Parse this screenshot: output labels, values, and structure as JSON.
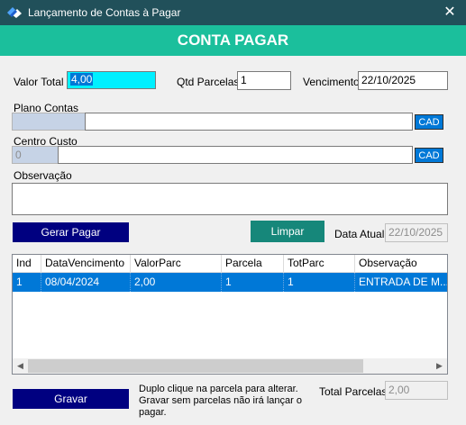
{
  "window": {
    "title": "Lançamento de Contas à Pagar",
    "close_glyph": "✕",
    "icon": "app-logo-icon"
  },
  "header": {
    "title": "CONTA PAGAR"
  },
  "form": {
    "valor_total": {
      "label": "Valor Total",
      "value": "4,00"
    },
    "qtd_parcelas": {
      "label": "Qtd Parcelas",
      "value": "1"
    },
    "vencimento": {
      "label": "Vencimento",
      "value": "22/10/2025"
    },
    "plano_contas": {
      "label": "Plano Contas",
      "code": "",
      "description": "",
      "cad_label": "CAD"
    },
    "centro_custo": {
      "label": "Centro Custo",
      "code": "0",
      "description": "",
      "cad_label": "CAD"
    },
    "observacao": {
      "label": "Observação",
      "value": ""
    },
    "data_atual": {
      "label": "Data Atual",
      "value": "22/10/2025"
    }
  },
  "buttons": {
    "gerar_pagar": "Gerar Pagar",
    "limpar": "Limpar",
    "gravar": "Gravar"
  },
  "grid": {
    "columns": [
      "Ind",
      "DataVencimento",
      "ValorParc",
      "Parcela",
      "TotParc",
      "Observação"
    ],
    "rows": [
      [
        "1",
        "08/04/2024",
        "2,00",
        "1",
        "1",
        "ENTRADA DE M..."
      ]
    ],
    "scroll_left": "◀",
    "scroll_right": "▶"
  },
  "footer": {
    "hint": "Duplo clique na parcela para alterar. Gravar sem parcelas não irá lançar o pagar.",
    "total_parcelas": {
      "label": "Total Parcelas",
      "value": "2,00"
    }
  },
  "colors": {
    "titlebar": "#21505a",
    "header_band": "#1bbf9c",
    "navy_button": "#000080",
    "teal_button": "#16877a",
    "selection": "#0078d7",
    "valor_total_bg": "#00f0ff"
  }
}
